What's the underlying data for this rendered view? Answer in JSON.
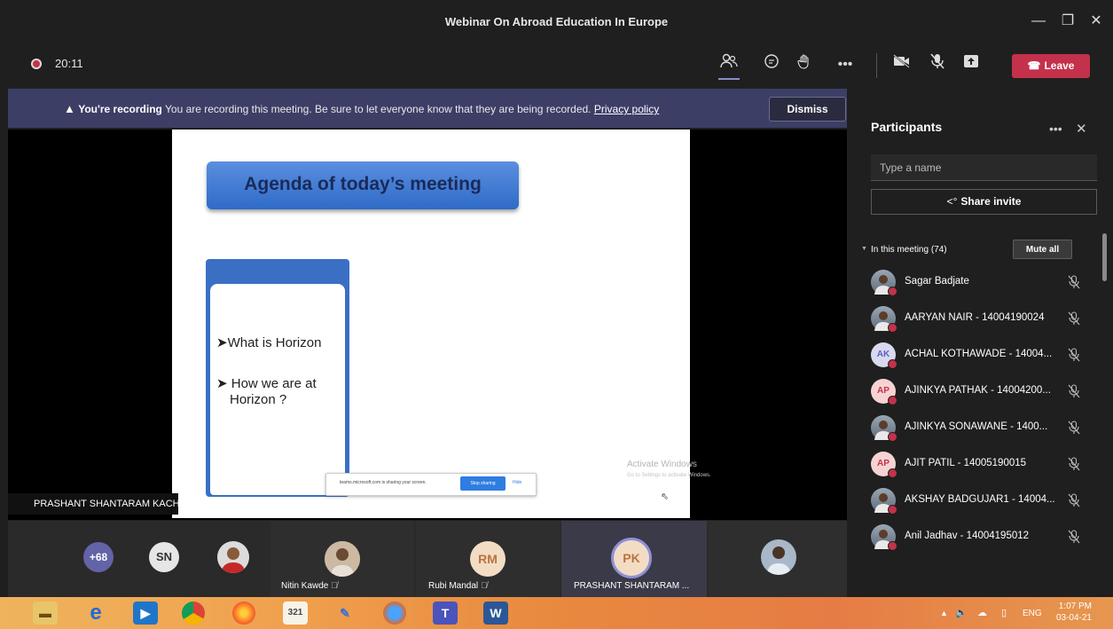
{
  "window": {
    "title": "Webinar On Abroad Education In Europe",
    "minimize": "—",
    "maximize": "❐",
    "close": "✕"
  },
  "controls": {
    "timer": "20:11",
    "leave_label": "Leave"
  },
  "banner": {
    "bold": "You're recording",
    "message": "You are recording this meeting. Be sure to let everyone know that they are being recorded.",
    "link": "Privacy policy",
    "dismiss": "Dismiss"
  },
  "slide": {
    "title": "Agenda of today’s meeting",
    "bullet1": "What is Horizon",
    "bullet2_line1": "How we are at",
    "bullet2_line2": "Horizon ?",
    "share_notice": "teams.microsoft.com is sharing your screen.",
    "stop_sharing": "Stop sharing",
    "hide": "Hide",
    "watermark_title": "Activate Windows",
    "watermark_sub": "Go to Settings to activate Windows."
  },
  "presenter_label": "PRASHANT SHANTARAM KACHAVE",
  "gallery": {
    "overflow": "+68",
    "sn": "SN",
    "tiles": [
      {
        "name": "Nitin Kawde"
      },
      {
        "initials": "RM",
        "name": "Rubi Mandal"
      },
      {
        "initials": "PK",
        "name": "PRASHANT SHANTARAM ..."
      }
    ]
  },
  "participants": {
    "title": "Participants",
    "search_placeholder": "Type a name",
    "share_invite": "Share invite",
    "in_meeting": "In this meeting (74)",
    "mute_all": "Mute all",
    "list": [
      {
        "name": "Sagar Badjate",
        "avatar": "photo"
      },
      {
        "name": "AARYAN NAIR - 14004190024",
        "avatar": "photo"
      },
      {
        "name": "ACHAL KOTHAWADE - 14004...",
        "initials": "AK"
      },
      {
        "name": "AJINKYA PATHAK - 14004200...",
        "initials": "AP"
      },
      {
        "name": "AJINKYA SONAWANE - 1400...",
        "avatar": "photo"
      },
      {
        "name": "AJIT PATIL - 14005190015",
        "initials": "AP"
      },
      {
        "name": "AKSHAY BADGUJAR1 - 14004...",
        "avatar": "photo"
      },
      {
        "name": "Anil Jadhav - 14004195012",
        "avatar": "photo"
      }
    ]
  },
  "tray": {
    "lang": "ENG",
    "time": "1:07 PM",
    "date": "03-04-21"
  }
}
